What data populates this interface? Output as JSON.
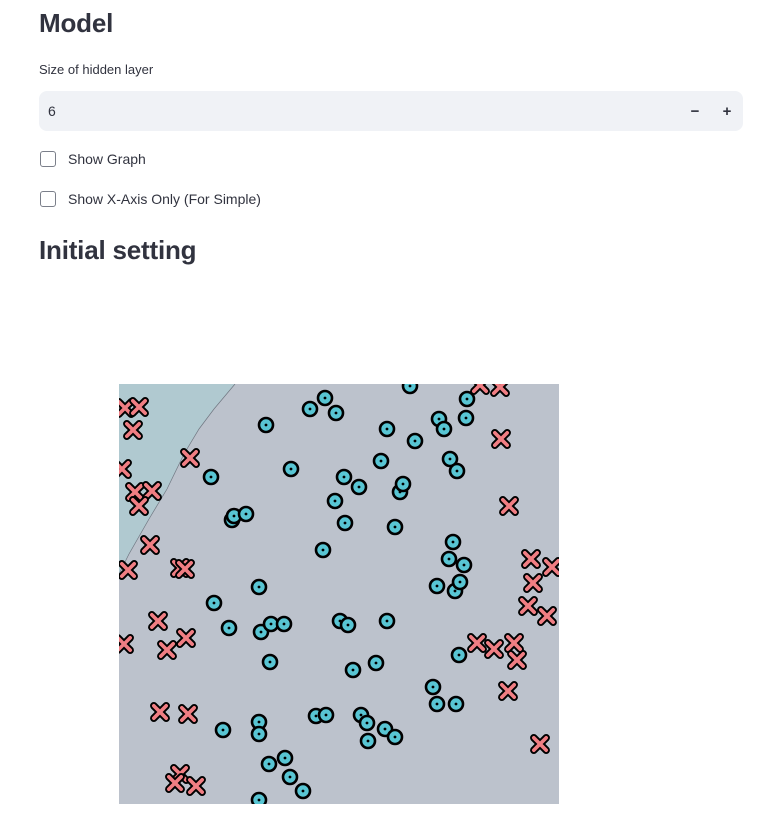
{
  "model_section": {
    "title": "Model",
    "hidden_layer_label": "Size of hidden layer",
    "hidden_layer_value": "6",
    "decrement_label": "−",
    "increment_label": "+"
  },
  "options": {
    "show_graph_label": "Show Graph",
    "show_graph_checked": false,
    "show_x_axis_label": "Show X-Axis Only (For Simple)",
    "show_x_axis_checked": false
  },
  "initial_section": {
    "title": "Initial setting"
  },
  "colors": {
    "region_default": "#bcc2cc",
    "region_alt": "#b0c9d0",
    "circle_fill": "#58c5d3",
    "cross_fill": "#f07e83",
    "marker_stroke": "#000000"
  },
  "chart_data": {
    "type": "scatter",
    "axes_visible": false,
    "xlim": [
      0,
      440
    ],
    "ylim": [
      0,
      420
    ],
    "decision_boundary": [
      [
        116,
        0
      ],
      [
        95,
        25
      ],
      [
        80,
        45
      ],
      [
        65,
        70
      ],
      [
        48,
        105
      ],
      [
        30,
        135
      ],
      [
        10,
        170
      ],
      [
        0,
        190
      ]
    ],
    "series": [
      {
        "marker": "circle",
        "points": [
          [
            147,
            41
          ],
          [
            191,
            25
          ],
          [
            206,
            14
          ],
          [
            217,
            29
          ],
          [
            268,
            45
          ],
          [
            296,
            57
          ],
          [
            320,
            35
          ],
          [
            325,
            45
          ],
          [
            348,
            15
          ],
          [
            347,
            34
          ],
          [
            291,
            2
          ],
          [
            172,
            85
          ],
          [
            92,
            93
          ],
          [
            262,
            77
          ],
          [
            331,
            75
          ],
          [
            338,
            87
          ],
          [
            225,
            93
          ],
          [
            240,
            103
          ],
          [
            281,
            108
          ],
          [
            284,
            100
          ],
          [
            216,
            117
          ],
          [
            226,
            139
          ],
          [
            113,
            136
          ],
          [
            115,
            132
          ],
          [
            127,
            130
          ],
          [
            276,
            143
          ],
          [
            204,
            166
          ],
          [
            334,
            158
          ],
          [
            330,
            175
          ],
          [
            345,
            181
          ],
          [
            140,
            203
          ],
          [
            95,
            219
          ],
          [
            318,
            202
          ],
          [
            336,
            207
          ],
          [
            341,
            198
          ],
          [
            110,
            244
          ],
          [
            142,
            248
          ],
          [
            152,
            240
          ],
          [
            165,
            240
          ],
          [
            221,
            237
          ],
          [
            229,
            241
          ],
          [
            268,
            237
          ],
          [
            151,
            278
          ],
          [
            234,
            286
          ],
          [
            257,
            279
          ],
          [
            340,
            271
          ],
          [
            314,
            303
          ],
          [
            318,
            320
          ],
          [
            337,
            320
          ],
          [
            197,
            332
          ],
          [
            207,
            331
          ],
          [
            242,
            331
          ],
          [
            104,
            346
          ],
          [
            248,
            339
          ],
          [
            140,
            338
          ],
          [
            140,
            350
          ],
          [
            266,
            345
          ],
          [
            276,
            353
          ],
          [
            249,
            357
          ],
          [
            166,
            374
          ],
          [
            150,
            380
          ],
          [
            171,
            393
          ],
          [
            140,
            416
          ],
          [
            184,
            407
          ]
        ]
      },
      {
        "marker": "cross",
        "points": [
          [
            6,
            24
          ],
          [
            20,
            23
          ],
          [
            14,
            46
          ],
          [
            3,
            85
          ],
          [
            71,
            74
          ],
          [
            16,
            108
          ],
          [
            33,
            107
          ],
          [
            20,
            122
          ],
          [
            31,
            161
          ],
          [
            9,
            186
          ],
          [
            61,
            184
          ],
          [
            66,
            185
          ],
          [
            361,
            1
          ],
          [
            381,
            3
          ],
          [
            382,
            55
          ],
          [
            390,
            122
          ],
          [
            412,
            175
          ],
          [
            433,
            183
          ],
          [
            414,
            199
          ],
          [
            409,
            222
          ],
          [
            428,
            232
          ],
          [
            39,
            237
          ],
          [
            48,
            266
          ],
          [
            67,
            254
          ],
          [
            5,
            260
          ],
          [
            358,
            259
          ],
          [
            375,
            265
          ],
          [
            395,
            259
          ],
          [
            398,
            276
          ],
          [
            389,
            307
          ],
          [
            41,
            328
          ],
          [
            69,
            330
          ],
          [
            421,
            360
          ],
          [
            61,
            390
          ],
          [
            56,
            399
          ],
          [
            77,
            402
          ]
        ]
      }
    ]
  }
}
